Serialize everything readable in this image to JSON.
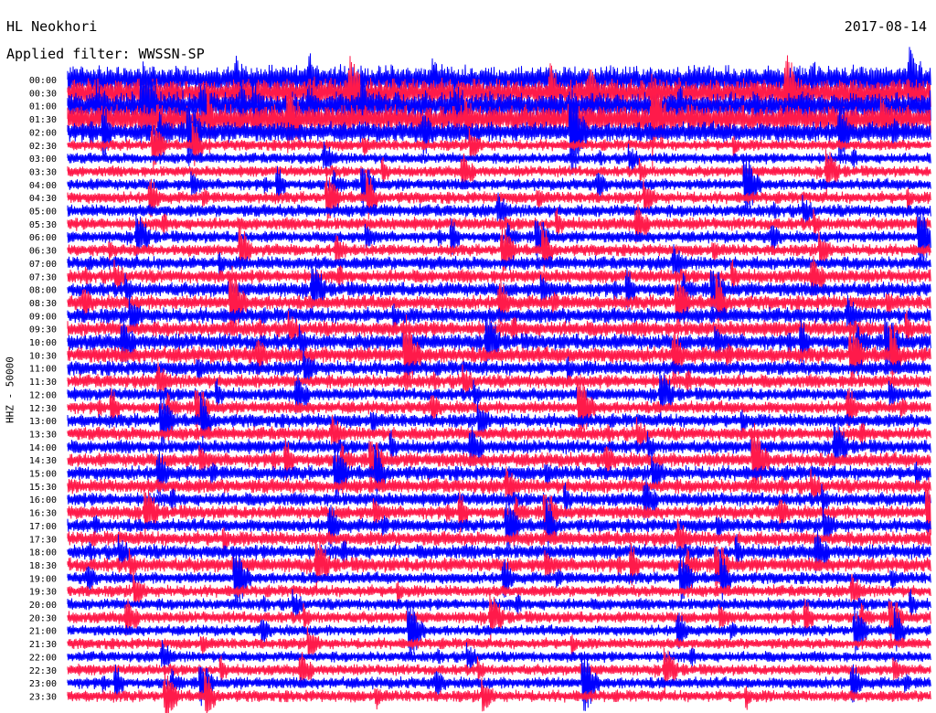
{
  "header": {
    "station": "HL Neokhori",
    "date": "2017-08-14",
    "filter_label": "Applied filter: WWSSN-SP"
  },
  "chart_data": {
    "type": "line",
    "title": "HL Neokhori",
    "subtitle": "Applied filter: WWSSN-SP",
    "date": "2017-08-14",
    "ylabel": "HHZ - 50000",
    "xlabel": "",
    "tick_labels": [
      "00:00",
      "00:30",
      "01:00",
      "01:30",
      "02:00",
      "02:30",
      "03:00",
      "03:30",
      "04:00",
      "04:30",
      "05:00",
      "05:30",
      "06:00",
      "06:30",
      "07:00",
      "07:30",
      "08:00",
      "08:30",
      "09:00",
      "09:30",
      "10:00",
      "10:30",
      "11:00",
      "11:30",
      "12:00",
      "12:30",
      "13:00",
      "13:30",
      "14:00",
      "14:30",
      "15:00",
      "15:30",
      "16:00",
      "16:30",
      "17:00",
      "17:30",
      "18:00",
      "18:30",
      "19:00",
      "19:30",
      "20:00",
      "20:30",
      "21:00",
      "21:30",
      "22:00",
      "22:30",
      "23:00",
      "23:30"
    ],
    "series_colors": [
      "#0000ff",
      "#ff1a4a"
    ],
    "row_activity": [
      3.0,
      3.0,
      3.0,
      3.0,
      2.2,
      1.2,
      1.2,
      1.2,
      1.3,
      1.3,
      1.4,
      1.4,
      1.3,
      1.3,
      1.5,
      1.5,
      1.6,
      1.6,
      1.7,
      1.7,
      1.8,
      1.8,
      1.6,
      1.5,
      1.4,
      1.4,
      1.5,
      1.5,
      1.5,
      1.6,
      1.6,
      1.6,
      1.5,
      1.5,
      1.5,
      1.6,
      1.6,
      1.6,
      1.3,
      1.3,
      1.3,
      1.3,
      1.2,
      1.2,
      1.2,
      1.2,
      1.3,
      1.3
    ]
  },
  "colors": {
    "background": "#ffffff",
    "blue": "#0000ff",
    "red": "#ff1a4a"
  }
}
